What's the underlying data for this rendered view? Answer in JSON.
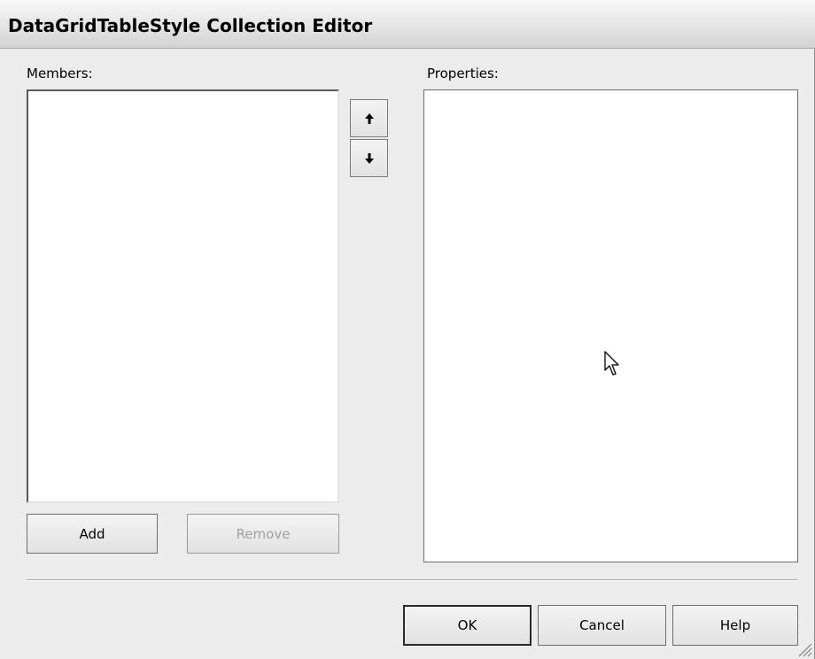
{
  "window": {
    "title": "DataGridTableStyle Collection Editor"
  },
  "members": {
    "label": "Members:",
    "items": []
  },
  "properties": {
    "label": "Properties:"
  },
  "buttons": {
    "move_up_icon": "arrow-up-icon",
    "move_down_icon": "arrow-down-icon",
    "add": "Add",
    "remove": "Remove",
    "ok": "OK",
    "cancel": "Cancel",
    "help": "Help"
  },
  "colors": {
    "dialog_bg": "#ececec",
    "list_bg": "#ffffff",
    "disabled_text": "#a0a0a0"
  }
}
